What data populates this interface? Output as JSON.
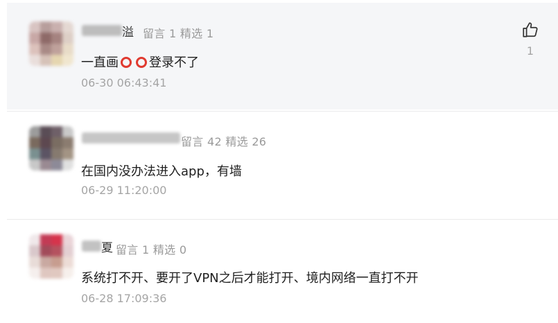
{
  "comments": [
    {
      "name_visible": "溢",
      "stats": "留言 1 精选 1",
      "text_before": "一直画",
      "text_after": "登录不了",
      "time": "06-30 06:43:41",
      "likes": "1",
      "icons": [
        "red-circle-emoji-icon",
        "red-circle-emoji-icon"
      ]
    },
    {
      "name_visible": "",
      "stats": "留言 42 精选 26",
      "text": "在国内没办法进入app，有墙",
      "time": "06-29 11:20:00"
    },
    {
      "name_visible": "夏",
      "stats": "留言 1 精选 0",
      "text": "系统打不开、要开了VPN之后才能打开、境内网络一直打不开",
      "time": "06-28 17:09:36"
    }
  ],
  "colors": {
    "highlight_bg": "#f5f6f8",
    "meta": "#9a9a9a",
    "emoji_red": "#e03a30",
    "accent_green": "#33b36a"
  }
}
